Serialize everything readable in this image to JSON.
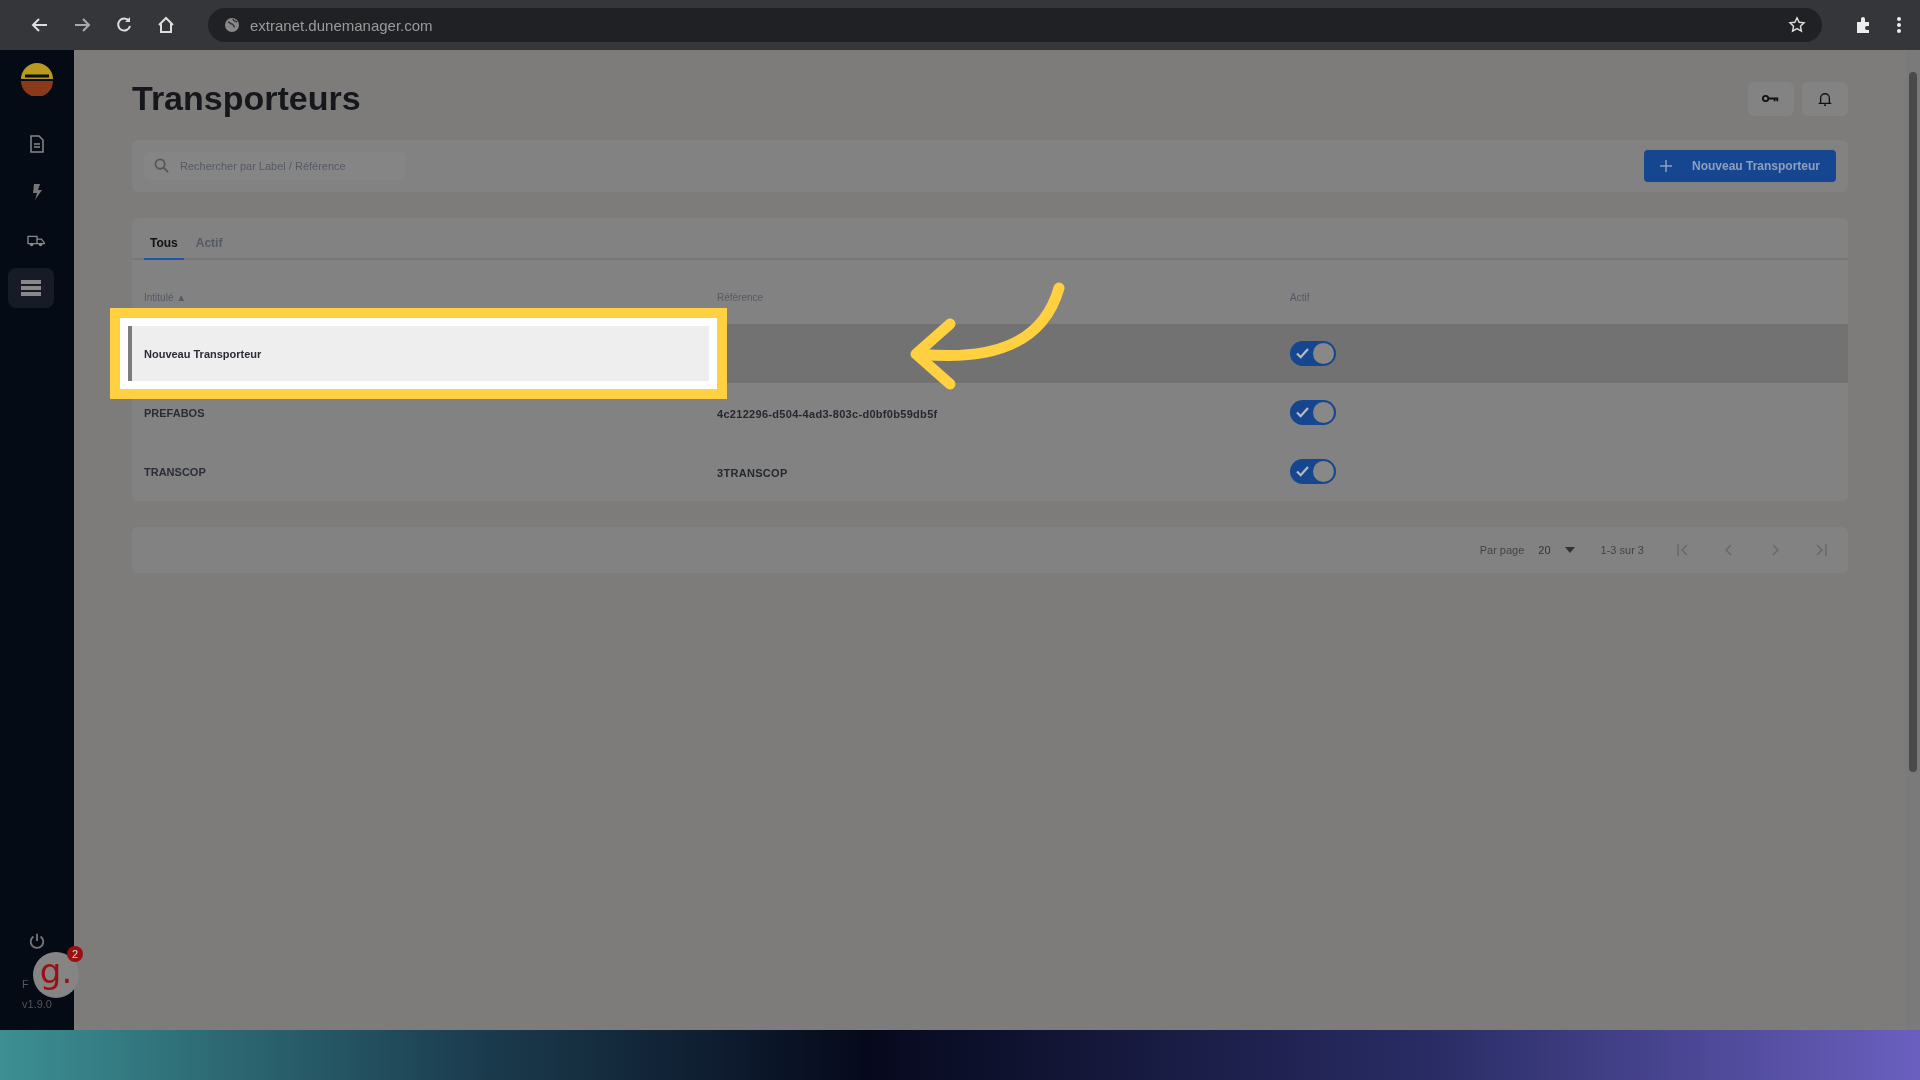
{
  "browser": {
    "url": "extranet.dunemanager.com"
  },
  "sidebar": {
    "items": [
      {
        "selected": false
      },
      {
        "selected": false
      },
      {
        "selected": false
      },
      {
        "selected": true
      }
    ],
    "language": "F",
    "version": "v1.9.0"
  },
  "helper_badge": {
    "glyph": "g.",
    "count": "2"
  },
  "page": {
    "title": "Transporteurs"
  },
  "search": {
    "placeholder": "Rechercher par Label / Référence"
  },
  "new_button": {
    "label": "Nouveau Transporteur"
  },
  "tabs": [
    {
      "label": "Tous",
      "selected": true
    },
    {
      "label": "Actif",
      "selected": false
    }
  ],
  "table": {
    "columns": [
      {
        "label": "Intitulé",
        "sort": "▲"
      },
      {
        "label": "Référence"
      },
      {
        "label": "Actif"
      }
    ],
    "rows": [
      {
        "name": "Nouveau Transporteur",
        "on": true,
        "highlighted": true
      },
      {
        "name": "PREFABOS",
        "reference": "4c212296-d504-4ad3-803c-d0bf0b59db5f",
        "on": true,
        "highlighted": false
      },
      {
        "name": "TRANSCOP",
        "reference": "3TRANSCOP",
        "on": true,
        "highlighted": false
      }
    ]
  },
  "pagination": {
    "per_page_label": "Par page",
    "per_page": "20",
    "range": "1-3 sur 3"
  }
}
